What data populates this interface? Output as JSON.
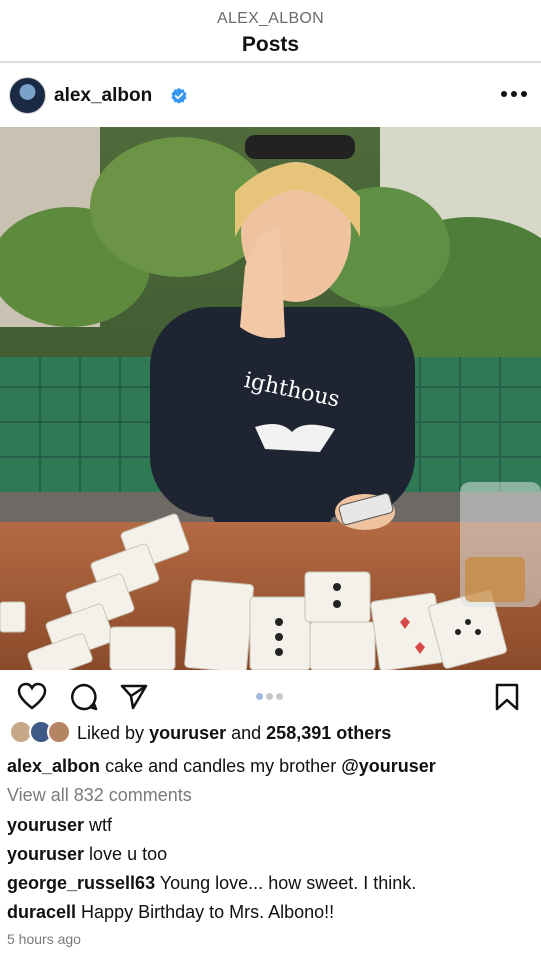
{
  "header": {
    "username": "ALEX_ALBON",
    "title": "Posts"
  },
  "post": {
    "author": "alex_albon",
    "verified": true,
    "image_description_hidden": ""
  },
  "photo": {
    "shirt_text": "ighthous"
  },
  "likes": {
    "prefix": "Liked by",
    "user": "youruser",
    "joiner": "and",
    "count_text": "258,391 others"
  },
  "caption": {
    "user": "alex_albon",
    "text": "cake and candles my brother",
    "mention": "@youruser"
  },
  "view_comments": "View all 832 comments",
  "comments": [
    {
      "user": "youruser",
      "text": "wtf"
    },
    {
      "user": "youruser",
      "text": "love u too"
    },
    {
      "user": "george_russell63",
      "text": "Young love... how sweet. I think."
    },
    {
      "user": "duracell",
      "text": "Happy Birthday to Mrs. Albono!!"
    }
  ],
  "timestamp": "5 hours ago",
  "icons": [
    "heart-icon",
    "comment-icon",
    "share-icon",
    "bookmark-icon",
    "more-icon",
    "verified-icon"
  ],
  "colors": {
    "verified": "#3897f0",
    "muted": "#7a7a7a",
    "text": "#111111"
  }
}
